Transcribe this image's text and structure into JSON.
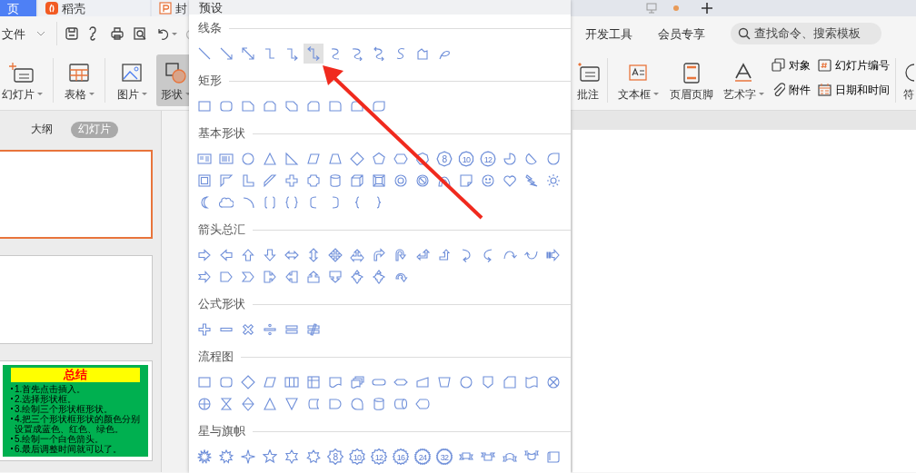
{
  "tabs": [
    {
      "label": "页",
      "selected": true
    },
    {
      "label": "稻壳",
      "selected": false
    },
    {
      "label": "封",
      "selected": false
    }
  ],
  "menu": {
    "file": "文件",
    "items": [
      "开发工具",
      "会员专享"
    ]
  },
  "search": {
    "placeholder": "查找命令、搜索模板"
  },
  "ribbon": {
    "left": [
      {
        "label": "幻灯片",
        "dropdown": true,
        "selected": false
      },
      {
        "label": "表格",
        "dropdown": true,
        "selected": false
      },
      {
        "label": "图片",
        "dropdown": true,
        "selected": false
      },
      {
        "label": "形状",
        "dropdown": true,
        "selected": true
      }
    ],
    "right": [
      {
        "label": "批注",
        "dropdown": false
      },
      {
        "label": "文本框",
        "dropdown": true
      },
      {
        "label": "页眉页脚",
        "dropdown": false
      },
      {
        "label": "艺术字",
        "dropdown": true
      }
    ],
    "small": [
      {
        "label": "对象"
      },
      {
        "label": "附件"
      },
      {
        "label": "幻灯片编号"
      },
      {
        "label": "日期和时间"
      }
    ],
    "cut_label": "符"
  },
  "panel": {
    "tabs": [
      {
        "label": "大纲",
        "selected": false
      },
      {
        "label": "幻灯片",
        "selected": true
      }
    ]
  },
  "slides": [
    {
      "selected": true
    },
    {
      "selected": false
    },
    {
      "selected": false,
      "title": "总结",
      "bullets": [
        "1.首先点击插入。",
        "2.选择形状框。",
        "3.绘制三个形状框形状。",
        "4.把三个形状框形状的颜色分别设置成蓝色、红色、绿色。",
        "5.绘制一个白色箭头。",
        "6.最后调整时间就可以了。"
      ]
    }
  ],
  "shape_gallery": {
    "header": "预设",
    "sections": [
      {
        "title": "线条",
        "items": [
          {
            "selected": false
          },
          {
            "selected": false
          },
          {
            "selected": false
          },
          {
            "selected": false
          },
          {
            "selected": false
          },
          {
            "selected": true
          },
          {
            "selected": false
          },
          {
            "selected": false
          },
          {
            "selected": false
          },
          {
            "selected": false
          },
          {
            "selected": false
          },
          {
            "selected": false
          }
        ]
      },
      {
        "title": "矩形",
        "items": [
          {
            "selected": false
          },
          {
            "selected": false
          },
          {
            "selected": false
          },
          {
            "selected": false
          },
          {
            "selected": false
          },
          {
            "selected": false
          },
          {
            "selected": false
          },
          {
            "selected": false
          },
          {
            "selected": false
          }
        ]
      },
      {
        "title": "基本形状",
        "items": [
          {
            "selected": false
          },
          {
            "selected": false
          },
          {
            "selected": false
          },
          {
            "selected": false
          },
          {
            "selected": false
          },
          {
            "selected": false
          },
          {
            "selected": false
          },
          {
            "selected": false
          },
          {
            "selected": false
          },
          {
            "selected": false
          },
          {
            "selected": false
          },
          {
            "selected": false,
            "label": "8"
          },
          {
            "selected": false,
            "label": "10"
          },
          {
            "selected": false,
            "label": "12"
          },
          {
            "selected": false
          },
          {
            "selected": false
          },
          {
            "selected": false
          },
          {
            "selected": false
          },
          {
            "selected": false
          },
          {
            "selected": false
          },
          {
            "selected": false
          },
          {
            "selected": false
          },
          {
            "selected": false
          },
          {
            "selected": false
          },
          {
            "selected": false
          },
          {
            "selected": false
          },
          {
            "selected": false
          },
          {
            "selected": false
          },
          {
            "selected": false
          },
          {
            "selected": false
          },
          {
            "selected": false
          },
          {
            "selected": false
          },
          {
            "selected": false
          },
          {
            "selected": false
          },
          {
            "selected": false
          },
          {
            "selected": false
          },
          {
            "selected": false
          },
          {
            "selected": false
          },
          {
            "selected": false
          },
          {
            "selected": false
          },
          {
            "selected": false
          },
          {
            "selected": false
          },
          {
            "selected": false
          }
        ]
      },
      {
        "title": "箭头总汇",
        "items": [
          {
            "selected": false
          },
          {
            "selected": false
          },
          {
            "selected": false
          },
          {
            "selected": false
          },
          {
            "selected": false
          },
          {
            "selected": false
          },
          {
            "selected": false
          },
          {
            "selected": false
          },
          {
            "selected": false
          },
          {
            "selected": false
          },
          {
            "selected": false
          },
          {
            "selected": false
          },
          {
            "selected": false
          },
          {
            "selected": false
          },
          {
            "selected": false
          },
          {
            "selected": false
          },
          {
            "selected": false
          },
          {
            "selected": false
          },
          {
            "selected": false
          },
          {
            "selected": false
          },
          {
            "selected": false
          },
          {
            "selected": false
          },
          {
            "selected": false
          },
          {
            "selected": false
          },
          {
            "selected": false
          },
          {
            "selected": false
          },
          {
            "selected": false
          }
        ]
      },
      {
        "title": "公式形状",
        "items": [
          {
            "selected": false
          },
          {
            "selected": false
          },
          {
            "selected": false
          },
          {
            "selected": false
          },
          {
            "selected": false
          },
          {
            "selected": false
          }
        ]
      },
      {
        "title": "流程图",
        "items": [
          {
            "selected": false
          },
          {
            "selected": false
          },
          {
            "selected": false
          },
          {
            "selected": false
          },
          {
            "selected": false
          },
          {
            "selected": false
          },
          {
            "selected": false
          },
          {
            "selected": false
          },
          {
            "selected": false
          },
          {
            "selected": false
          },
          {
            "selected": false
          },
          {
            "selected": false
          },
          {
            "selected": false
          },
          {
            "selected": false
          },
          {
            "selected": false
          },
          {
            "selected": false
          },
          {
            "selected": false
          },
          {
            "selected": false
          },
          {
            "selected": false
          },
          {
            "selected": false
          },
          {
            "selected": false
          },
          {
            "selected": false
          },
          {
            "selected": false
          },
          {
            "selected": false
          },
          {
            "selected": false
          },
          {
            "selected": false
          },
          {
            "selected": false
          },
          {
            "selected": false
          }
        ]
      },
      {
        "title": "星与旗帜",
        "items": [
          {
            "selected": false
          },
          {
            "selected": false
          },
          {
            "selected": false
          },
          {
            "selected": false
          },
          {
            "selected": false
          },
          {
            "selected": false
          },
          {
            "selected": false,
            "label": "8"
          },
          {
            "selected": false,
            "label": "10"
          },
          {
            "selected": false,
            "label": "12"
          },
          {
            "selected": false,
            "label": "16"
          },
          {
            "selected": false,
            "label": "24"
          },
          {
            "selected": false,
            "label": "32"
          },
          {
            "selected": false
          },
          {
            "selected": false
          },
          {
            "selected": false
          },
          {
            "selected": false
          },
          {
            "selected": false
          }
        ]
      }
    ]
  }
}
